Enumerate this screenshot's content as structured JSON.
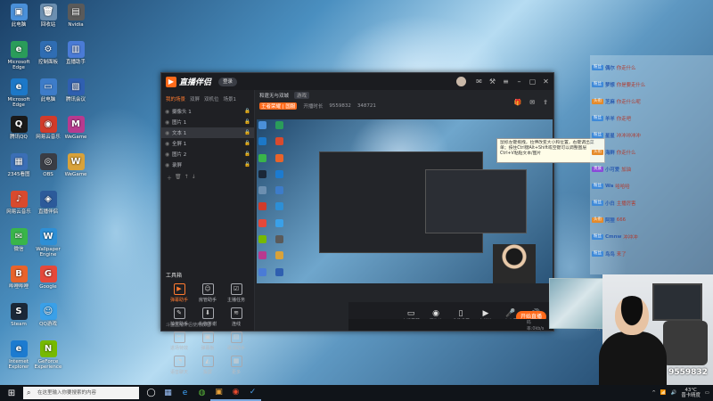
{
  "desktop": {
    "icons_col1": [
      {
        "label": "此电脑",
        "color": "#4a90d9",
        "glyph": "▣"
      },
      {
        "label": "Microsoft Edge",
        "color": "#2a9c5a",
        "glyph": "e"
      },
      {
        "label": "Microsoft Edge",
        "color": "#1c78c8",
        "glyph": "e"
      },
      {
        "label": "腾讯QQ",
        "color": "#1a1a1a",
        "glyph": "Q"
      },
      {
        "label": "2345看图",
        "color": "#3b6fb6",
        "glyph": "▦"
      },
      {
        "label": "网易云音乐",
        "color": "#d84a2e",
        "glyph": "♪"
      },
      {
        "label": "微信",
        "color": "#39b54a",
        "glyph": "✉"
      },
      {
        "label": "哔哩哔哩",
        "color": "#e8632b",
        "glyph": "B"
      },
      {
        "label": "Steam",
        "color": "#1b2838",
        "glyph": "S"
      },
      {
        "label": "Internet Explorer",
        "color": "#1c7bd0",
        "glyph": "e"
      }
    ],
    "icons_col2": [
      {
        "label": "回收站",
        "color": "#6c8fb0",
        "glyph": "🗑"
      },
      {
        "label": "控制面板",
        "color": "#2f6db3",
        "glyph": "⚙"
      },
      {
        "label": "此电脑",
        "color": "#3d7cc9",
        "glyph": "▭"
      },
      {
        "label": "网易云音乐",
        "color": "#d13b2a",
        "glyph": "◉"
      },
      {
        "label": "OBS",
        "color": "#3a3d45",
        "glyph": "◎"
      },
      {
        "label": "直播伴侣",
        "color": "#2c5a9a",
        "glyph": "◈"
      },
      {
        "label": "Wallpaper Engine",
        "color": "#2d8fd6",
        "glyph": "W"
      },
      {
        "label": "Google",
        "color": "#e5483a",
        "glyph": "G"
      },
      {
        "label": "QQ游戏",
        "color": "#3aa0e8",
        "glyph": "☺"
      },
      {
        "label": "GeForce Experience",
        "color": "#76b900",
        "glyph": "N"
      }
    ],
    "icons_col3": [
      {
        "label": "Nvidia",
        "color": "#5a5a5a",
        "glyph": "▤"
      },
      {
        "label": "直播助手",
        "color": "#4a7bd6",
        "glyph": "▥"
      },
      {
        "label": "腾讯会议",
        "color": "#2f5fb0",
        "glyph": "▧"
      },
      {
        "label": "WeGame",
        "color": "#b83a8f",
        "glyph": "M"
      },
      {
        "label": "WeGame",
        "color": "#d8a23a",
        "glyph": "W"
      }
    ]
  },
  "app": {
    "title": "直播伴侣",
    "login_label": "登录",
    "left_tabs": [
      "我的场景",
      "双屏",
      "双机位",
      "场景1"
    ],
    "scenes": [
      {
        "name": "摄像头 1",
        "selected": false
      },
      {
        "name": "图片 1",
        "selected": false
      },
      {
        "name": "文本 1",
        "selected": true
      },
      {
        "name": "全屏 1",
        "selected": false
      },
      {
        "name": "图片 2",
        "selected": false
      },
      {
        "name": "录屏",
        "selected": false
      }
    ],
    "tools_title": "工具箱",
    "tools": [
      {
        "label": "弹幕助手",
        "glyph": "▶",
        "hot": true
      },
      {
        "label": "房管助手",
        "glyph": "☺",
        "hot": false
      },
      {
        "label": "主播任务",
        "glyph": "☑",
        "hot": false
      },
      {
        "label": "抽奖助手",
        "glyph": "✎",
        "hot": false
      },
      {
        "label": "礼物答谢",
        "glyph": "⬇",
        "hot": false
      },
      {
        "label": "连线",
        "glyph": "≋",
        "hot": false
      },
      {
        "label": "进场特效",
        "glyph": "✂",
        "hot": false
      },
      {
        "label": "弹幕板",
        "glyph": "▣",
        "hot": false
      },
      {
        "label": "歌词助手",
        "glyph": "▤",
        "hot": false
      },
      {
        "label": "语音聊天",
        "glyph": "◔",
        "hot": false
      },
      {
        "label": "投屏",
        "glyph": "◭",
        "hot": false
      },
      {
        "label": "更多",
        "glyph": "▦",
        "hot": false
      }
    ],
    "left_footer": "斗鱼直播伴侣使用教程",
    "room_label": "和霆无与双城",
    "room_tag": "游戏",
    "stats": [
      "王者荣耀 | 国服",
      "开播时长",
      "9559832",
      "348721"
    ],
    "tooltip": "鼠标左键拖拽，拉伸改变大小和位置，右键调出菜单；按住Ctrl键Alt+Shift或空键可以调整图层 Ctrl+V粘贴文本/图片",
    "live_tools": [
      {
        "label": "直播屏幕",
        "glyph": "▭"
      },
      {
        "label": "摄像头",
        "glyph": "◉"
      },
      {
        "label": "手机投屏",
        "glyph": "▯"
      },
      {
        "label": "多媒体",
        "glyph": "▶"
      },
      {
        "label": "麦克风",
        "glyph": "🎤"
      },
      {
        "label": "扬声器",
        "glyph": "🔊"
      }
    ],
    "go_live_label": "开始直播",
    "status_items": [
      "码率:0kb/s",
      "FPS:60",
      "CPU:8%",
      "内存:55%",
      "丢帧:0%"
    ],
    "status_time": "02:00:07"
  },
  "chat": {
    "lines": [
      {
        "badge": "粉丝",
        "badge_color": "#3f8ad9",
        "user": "偶尔",
        "msg": "你走什么"
      },
      {
        "badge": "粉丝",
        "badge_color": "#3f8ad9",
        "user": "梦想",
        "msg": "你是要走什么"
      },
      {
        "badge": "头衔",
        "badge_color": "#e58a2a",
        "user": "芝麻",
        "msg": "你走什么呢"
      },
      {
        "badge": "粉丝",
        "badge_color": "#3f8ad9",
        "user": "羊羊",
        "msg": "你走吧"
      },
      {
        "badge": "粉丝",
        "badge_color": "#3f8ad9",
        "user": "星星",
        "msg": "冲冲冲冲冲"
      },
      {
        "badge": "头衔",
        "badge_color": "#e58a2a",
        "user": "海鲜",
        "msg": "你走什么"
      },
      {
        "badge": "贵族",
        "badge_color": "#8a4ad9",
        "user": "小可爱",
        "msg": "加油"
      },
      {
        "badge": "粉丝",
        "badge_color": "#3f8ad9",
        "user": "Wa",
        "msg": "哈哈哈"
      },
      {
        "badge": "粉丝",
        "badge_color": "#3f8ad9",
        "user": "小白",
        "msg": "主播厉害"
      },
      {
        "badge": "头衔",
        "badge_color": "#e58a2a",
        "user": "阿狸",
        "msg": "666"
      },
      {
        "badge": "粉丝",
        "badge_color": "#3f8ad9",
        "user": "Cmnw",
        "msg": "冲冲冲"
      },
      {
        "badge": "粉丝",
        "badge_color": "#3f8ad9",
        "user": "鸟鸟",
        "msg": "来了"
      }
    ]
  },
  "stream": {
    "viewer_count": "9559832"
  },
  "taskbar": {
    "search_placeholder": "在这里输入你要搜索的内容",
    "weather": "43°C",
    "clock_line1": "晋卡晴度",
    "apps": [
      {
        "glyph": "◯",
        "color": "#ffffff"
      },
      {
        "glyph": "▦",
        "color": "#9ec6ff"
      },
      {
        "glyph": "e",
        "color": "#3ea6ff"
      },
      {
        "glyph": "◍",
        "color": "#5bb83a"
      },
      {
        "glyph": "▣",
        "color": "#e8a23a"
      },
      {
        "glyph": "◉",
        "color": "#e84a2e"
      },
      {
        "glyph": "✓",
        "color": "#4a9ee8"
      }
    ]
  }
}
